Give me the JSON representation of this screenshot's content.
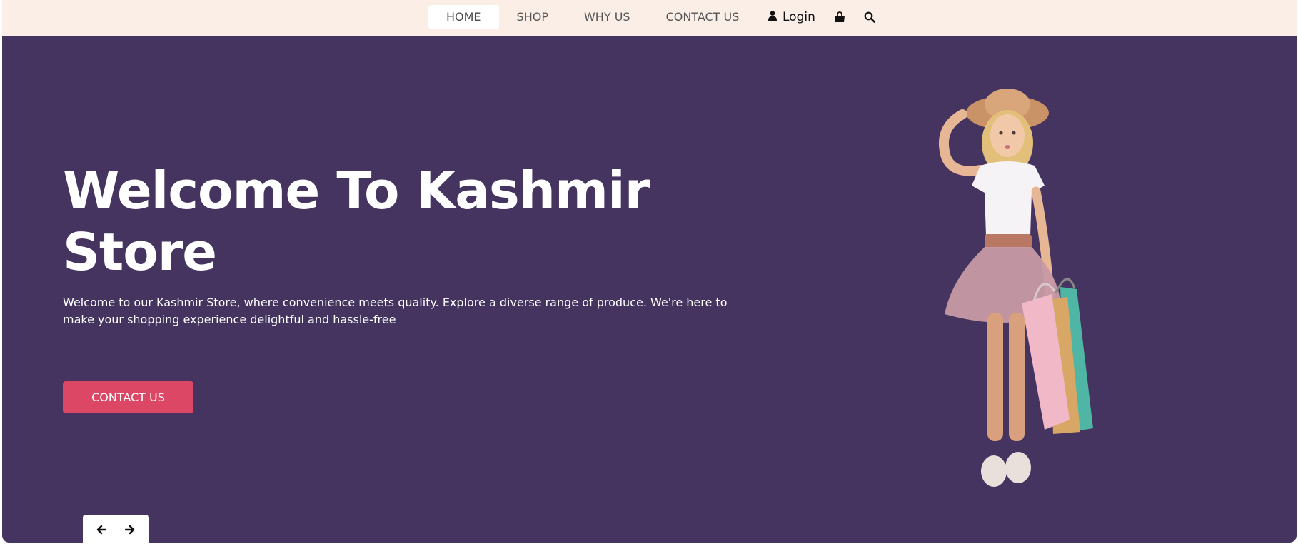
{
  "nav": {
    "items": [
      {
        "label": "HOME",
        "active": true
      },
      {
        "label": "SHOP",
        "active": false
      },
      {
        "label": "WHY US",
        "active": false
      },
      {
        "label": "CONTACT US",
        "active": false
      }
    ],
    "login_label": "Login",
    "icons": [
      "user-icon",
      "shopping-bag-icon",
      "search-icon"
    ]
  },
  "hero": {
    "title_line1": "Welcome To Kashmir",
    "title_line2": "Store",
    "text": "Welcome to our Kashmir Store, where convenience meets quality. Explore a diverse range of produce. We're here to make your shopping experience delightful and hassle-free",
    "cta_label": "CONTACT US"
  },
  "slider": {
    "icons": [
      "arrow-left-icon",
      "arrow-right-icon"
    ]
  },
  "colors": {
    "header_bg": "#faeee7",
    "hero_bg": "#45345f",
    "accent": "#dd4766"
  }
}
